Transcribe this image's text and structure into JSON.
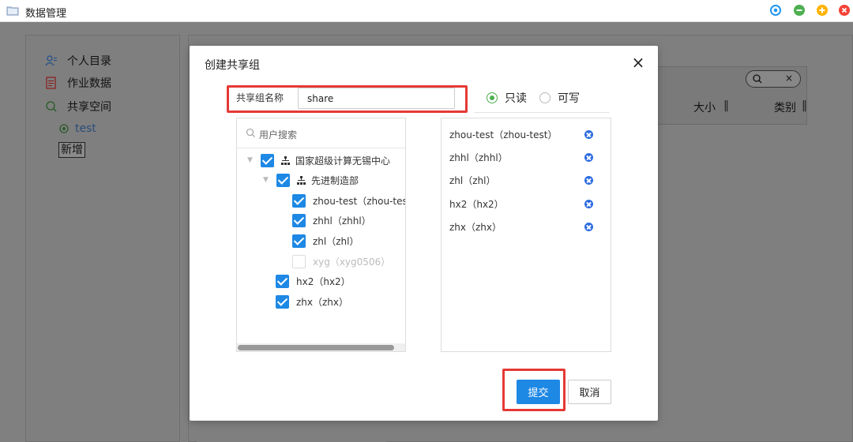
{
  "window": {
    "title": "数据管理",
    "controls": [
      "target-icon",
      "minimize-icon",
      "maximize-icon",
      "close-icon"
    ],
    "control_colors": [
      "#2196f3",
      "#4caf50",
      "#ffb300",
      "#f44336"
    ]
  },
  "sidebar": {
    "items": [
      {
        "label": "个人目录",
        "icon": "user-icon"
      },
      {
        "label": "作业数据",
        "icon": "document-icon"
      },
      {
        "label": "共享空间",
        "icon": "share-icon"
      }
    ],
    "sub_item": {
      "label": "test",
      "icon": "share-sub-icon"
    },
    "new_label": "新增"
  },
  "table": {
    "columns": [
      {
        "label": "大小"
      },
      {
        "label": "类别"
      }
    ],
    "search_clear": "×"
  },
  "dialog": {
    "title": "创建共享组",
    "close": "×",
    "name_label": "共享组名称",
    "name_value": "share",
    "permissions": [
      {
        "label": "只读",
        "checked": true
      },
      {
        "label": "可写",
        "checked": false
      }
    ],
    "user_search_placeholder": "用户搜索",
    "tree": [
      {
        "label": "国家超级计算无锡中心",
        "checked": true,
        "type": "org",
        "level": 0
      },
      {
        "label": "先进制造部",
        "checked": true,
        "type": "org",
        "level": 1
      },
      {
        "label": "zhou-test（zhou-test）",
        "checked": true,
        "type": "user",
        "level": 2
      },
      {
        "label": "zhhl（zhhl）",
        "checked": true,
        "type": "user",
        "level": 2
      },
      {
        "label": "zhl（zhl）",
        "checked": true,
        "type": "user",
        "level": 2
      },
      {
        "label": "xyg（xyg0506）",
        "checked": false,
        "disabled": true,
        "type": "user",
        "level": 2
      },
      {
        "label": "hx2（hx2）",
        "checked": true,
        "type": "user",
        "level": 1
      },
      {
        "label": "zhx（zhx）",
        "checked": true,
        "type": "user",
        "level": 1
      }
    ],
    "selected": [
      "zhou-test（zhou-test）",
      "zhhl（zhhl）",
      "zhl（zhl）",
      "hx2（hx2）",
      "zhx（zhx）"
    ],
    "submit_label": "提交",
    "cancel_label": "取消",
    "accent_color": "#1e88e5",
    "highlight_color": "#e53935"
  }
}
